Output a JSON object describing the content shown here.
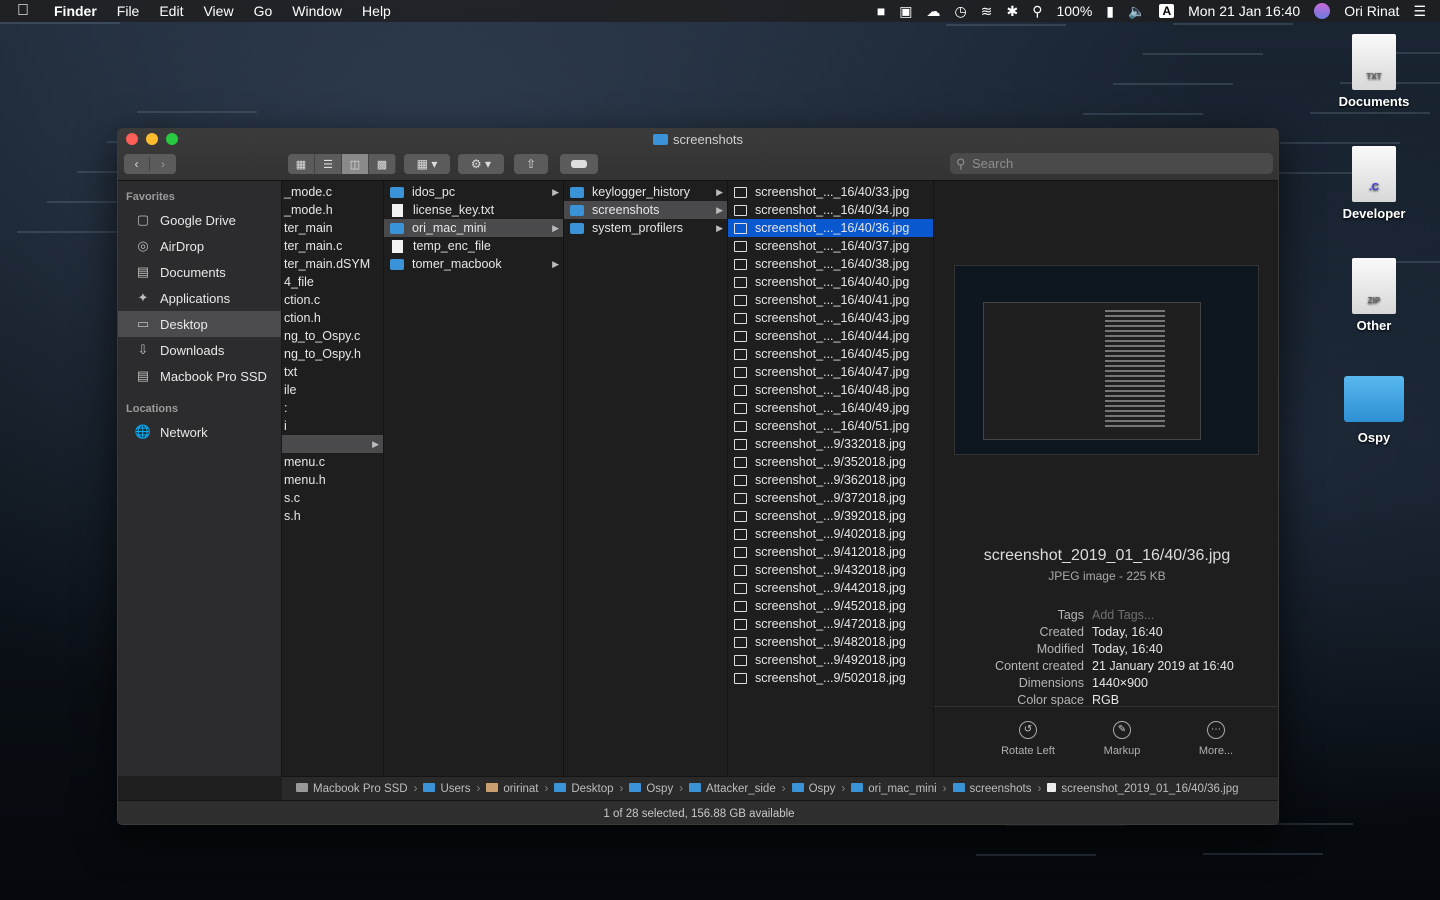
{
  "menubar": {
    "app": "Finder",
    "menus": [
      "File",
      "Edit",
      "View",
      "Go",
      "Window",
      "Help"
    ],
    "battery": "100%",
    "input_source": "A",
    "datetime": "Mon 21 Jan  16:40",
    "user": "Ori Rinat"
  },
  "desktop_icons": [
    {
      "label": "Documents",
      "badge": "TXT",
      "kind": "doc"
    },
    {
      "label": "Developer",
      "badge": ".C",
      "kind": "doc"
    },
    {
      "label": "Other",
      "badge": "ZIP",
      "kind": "doc"
    },
    {
      "label": "Ospy",
      "badge": "",
      "kind": "folder"
    }
  ],
  "window": {
    "title": "screenshots",
    "search_placeholder": "Search"
  },
  "sidebar": {
    "favorites_heading": "Favorites",
    "favorites": [
      {
        "label": "Google Drive",
        "icon": "folder-icon"
      },
      {
        "label": "AirDrop",
        "icon": "airdrop-icon"
      },
      {
        "label": "Documents",
        "icon": "documents-icon"
      },
      {
        "label": "Applications",
        "icon": "applications-icon"
      },
      {
        "label": "Desktop",
        "icon": "desktop-icon",
        "selected": true
      },
      {
        "label": "Downloads",
        "icon": "downloads-icon"
      },
      {
        "label": "Macbook Pro SSD",
        "icon": "disk-icon"
      }
    ],
    "locations_heading": "Locations",
    "locations": [
      {
        "label": "Network",
        "icon": "network-icon"
      }
    ]
  },
  "columns": {
    "col1": [
      "_mode.c",
      "_mode.h",
      "ter_main",
      "ter_main.c",
      "ter_main.dSYM",
      "4_file",
      "ction.c",
      "ction.h",
      "ng_to_Ospy.c",
      "ng_to_Ospy.h",
      "txt",
      "ile",
      ":",
      "i",
      "",
      "menu.c",
      "menu.h",
      "s.c",
      "s.h"
    ],
    "col2": [
      {
        "name": "idos_pc",
        "type": "folder"
      },
      {
        "name": "license_key.txt",
        "type": "file"
      },
      {
        "name": "ori_mac_mini",
        "type": "folder",
        "selected": true
      },
      {
        "name": "temp_enc_file",
        "type": "file"
      },
      {
        "name": "tomer_macbook",
        "type": "folder"
      }
    ],
    "col3": [
      {
        "name": "keylogger_history",
        "type": "folder"
      },
      {
        "name": "screenshots",
        "type": "folder",
        "selected": true
      },
      {
        "name": "system_profilers",
        "type": "folder"
      }
    ],
    "col4": [
      "screenshot_..._16/40/33.jpg",
      "screenshot_..._16/40/34.jpg",
      "screenshot_..._16/40/36.jpg",
      "screenshot_..._16/40/37.jpg",
      "screenshot_..._16/40/38.jpg",
      "screenshot_..._16/40/40.jpg",
      "screenshot_..._16/40/41.jpg",
      "screenshot_..._16/40/43.jpg",
      "screenshot_..._16/40/44.jpg",
      "screenshot_..._16/40/45.jpg",
      "screenshot_..._16/40/47.jpg",
      "screenshot_..._16/40/48.jpg",
      "screenshot_..._16/40/49.jpg",
      "screenshot_..._16/40/51.jpg",
      "screenshot_...9/332018.jpg",
      "screenshot_...9/352018.jpg",
      "screenshot_...9/362018.jpg",
      "screenshot_...9/372018.jpg",
      "screenshot_...9/392018.jpg",
      "screenshot_...9/402018.jpg",
      "screenshot_...9/412018.jpg",
      "screenshot_...9/432018.jpg",
      "screenshot_...9/442018.jpg",
      "screenshot_...9/452018.jpg",
      "screenshot_...9/472018.jpg",
      "screenshot_...9/482018.jpg",
      "screenshot_...9/492018.jpg",
      "screenshot_...9/502018.jpg"
    ],
    "col4_selected_index": 2
  },
  "preview": {
    "filename": "screenshot_2019_01_16/40/36.jpg",
    "kind": "JPEG image - 225 KB",
    "meta": [
      {
        "key": "Tags",
        "value": "Add Tags..."
      },
      {
        "key": "Created",
        "value": "Today, 16:40"
      },
      {
        "key": "Modified",
        "value": "Today, 16:40"
      },
      {
        "key": "Content created",
        "value": "21 January 2019 at 16:40"
      },
      {
        "key": "Dimensions",
        "value": "1440×900"
      },
      {
        "key": "Color space",
        "value": "RGB"
      }
    ],
    "actions": [
      "Rotate Left",
      "Markup",
      "More..."
    ]
  },
  "pathbar": [
    "Macbook Pro SSD",
    "Users",
    "oririnat",
    "Desktop",
    "Ospy",
    "Attacker_side",
    "Ospy",
    "ori_mac_mini",
    "screenshots",
    "screenshot_2019_01_16/40/36.jpg"
  ],
  "status": "1 of 28 selected, 156.88 GB available",
  "colors": {
    "selection_blue": "#0a58d0",
    "folder_blue": "#3a93d6",
    "close": "#fc5f57",
    "minimize": "#fdbc2e",
    "zoom": "#28c840"
  }
}
